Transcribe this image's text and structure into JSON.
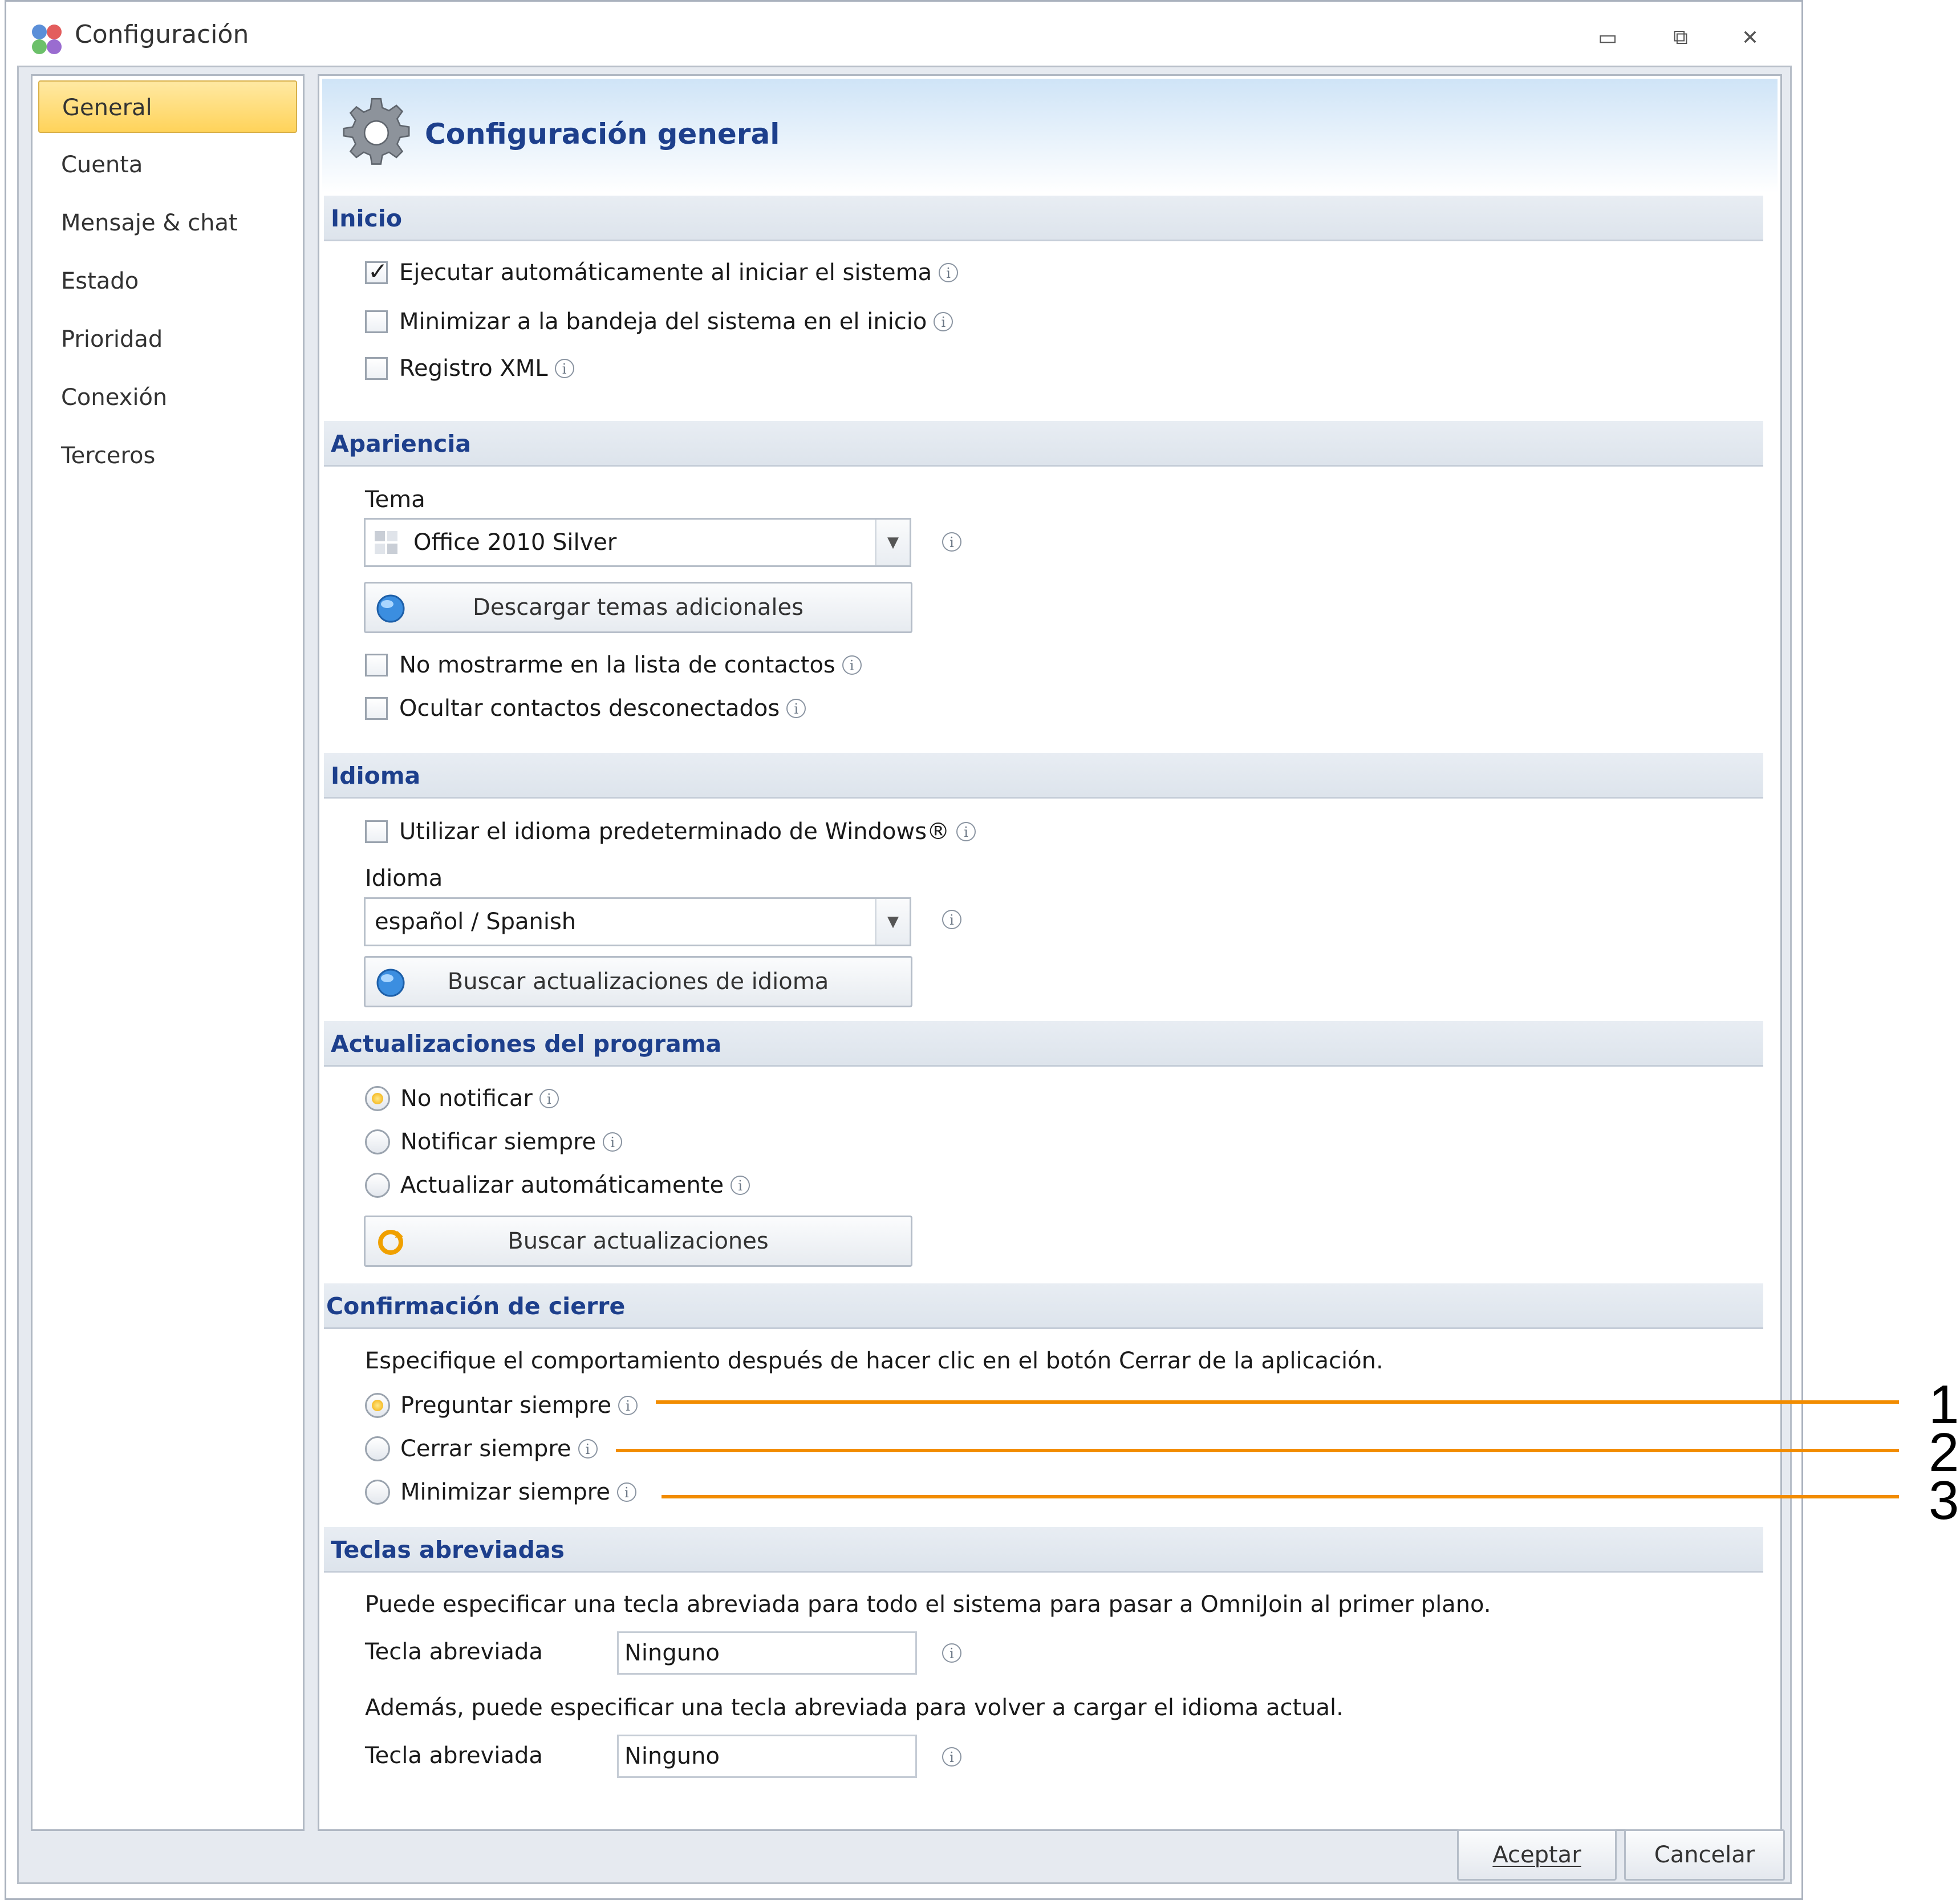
{
  "window": {
    "title": "Configuración",
    "controls": {
      "minimize": "▭",
      "restore": "⧉",
      "close": "✕"
    }
  },
  "sidebar": {
    "items": [
      {
        "label": "General",
        "active": true
      },
      {
        "label": "Cuenta"
      },
      {
        "label": "Mensaje & chat"
      },
      {
        "label": "Estado"
      },
      {
        "label": "Prioridad"
      },
      {
        "label": "Conexión"
      },
      {
        "label": "Terceros"
      }
    ]
  },
  "panel": {
    "title": "Configuración general",
    "inicio": {
      "header": "Inicio",
      "options": [
        {
          "label": "Ejecutar automáticamente al iniciar el sistema",
          "checked": true
        },
        {
          "label": "Minimizar a la bandeja del sistema en el inicio",
          "checked": false
        },
        {
          "label": "Registro XML",
          "checked": false
        }
      ]
    },
    "apariencia": {
      "header": "Apariencia",
      "tema_label": "Tema",
      "tema_value": "Office 2010 Silver",
      "download_button": "Descargar temas adicionales",
      "options": [
        {
          "label": "No mostrarme en la lista de contactos",
          "checked": false
        },
        {
          "label": "Ocultar contactos desconectados",
          "checked": false
        }
      ]
    },
    "idioma": {
      "header": "Idioma",
      "windows_option": {
        "label": "Utilizar el idioma predeterminado de Windows®",
        "checked": false
      },
      "idioma_label": "Idioma",
      "idioma_value": "español / Spanish",
      "update_button": "Buscar actualizaciones de idioma"
    },
    "actualizaciones": {
      "header": "Actualizaciones del programa",
      "options": [
        {
          "label": "No notificar",
          "selected": true
        },
        {
          "label": "Notificar siempre",
          "selected": false
        },
        {
          "label": "Actualizar automáticamente",
          "selected": false
        }
      ],
      "check_button": "Buscar actualizaciones"
    },
    "cierre": {
      "header": "Confirmación de cierre",
      "description": "Especifique el comportamiento después de hacer clic en el botón Cerrar de la aplicación.",
      "options": [
        {
          "label": "Preguntar siempre",
          "selected": true
        },
        {
          "label": "Cerrar siempre",
          "selected": false
        },
        {
          "label": "Minimizar siempre",
          "selected": false
        }
      ]
    },
    "teclas": {
      "header": "Teclas abreviadas",
      "description1": "Puede especificar una tecla abreviada para todo el sistema para pasar a OmniJoin al primer plano.",
      "hotkey1_label": "Tecla abreviada",
      "hotkey1_value": "Ninguno",
      "description2": "Además, puede especificar una tecla abreviada para volver a cargar el idioma actual.",
      "hotkey2_label": "Tecla abreviada",
      "hotkey2_value": "Ninguno"
    }
  },
  "footer": {
    "accept": "Aceptar",
    "cancel": "Cancelar"
  },
  "callouts": [
    "1",
    "2",
    "3"
  ],
  "colors": {
    "accent": "#1d3f8c",
    "callout": "#f28c00",
    "selected_nav": "#ffd35a"
  },
  "info_glyph": "i"
}
